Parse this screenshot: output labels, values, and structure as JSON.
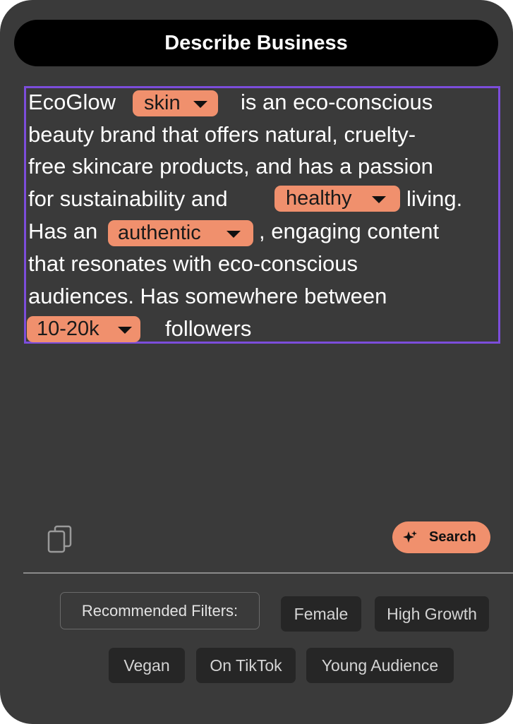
{
  "header": {
    "title": "Describe Business"
  },
  "description": {
    "segments": {
      "line1_a": "EcoGlow",
      "line1_b": "is an eco-conscious",
      "line2": "beauty brand that offers natural, cruelty-",
      "line3": "free skincare products, and has a passion",
      "line4_a": "for sustainability and",
      "line4_b": "living.",
      "line5_a": "Has an",
      "line5_b": ", engaging content",
      "line6": "that resonates with eco-conscious",
      "line7": "audiences. Has somewhere between",
      "line8": "followers"
    },
    "dropdowns": {
      "category": "skin",
      "lifestyle": "healthy",
      "tone": "authentic",
      "followers": "10-20k"
    }
  },
  "actions": {
    "search_label": "Search",
    "copy_icon": "copy-icon",
    "search_icon": "sparkle-icon"
  },
  "filters": {
    "label": "Recommended Filters:",
    "chips": [
      "Female",
      "High Growth",
      "Vegan",
      "On TikTok",
      "Young Audience"
    ]
  },
  "colors": {
    "accent": "#f0906d",
    "selection_border": "#7c4ddb",
    "card_bg": "#3a3a3a",
    "chip_bg": "#262626"
  }
}
